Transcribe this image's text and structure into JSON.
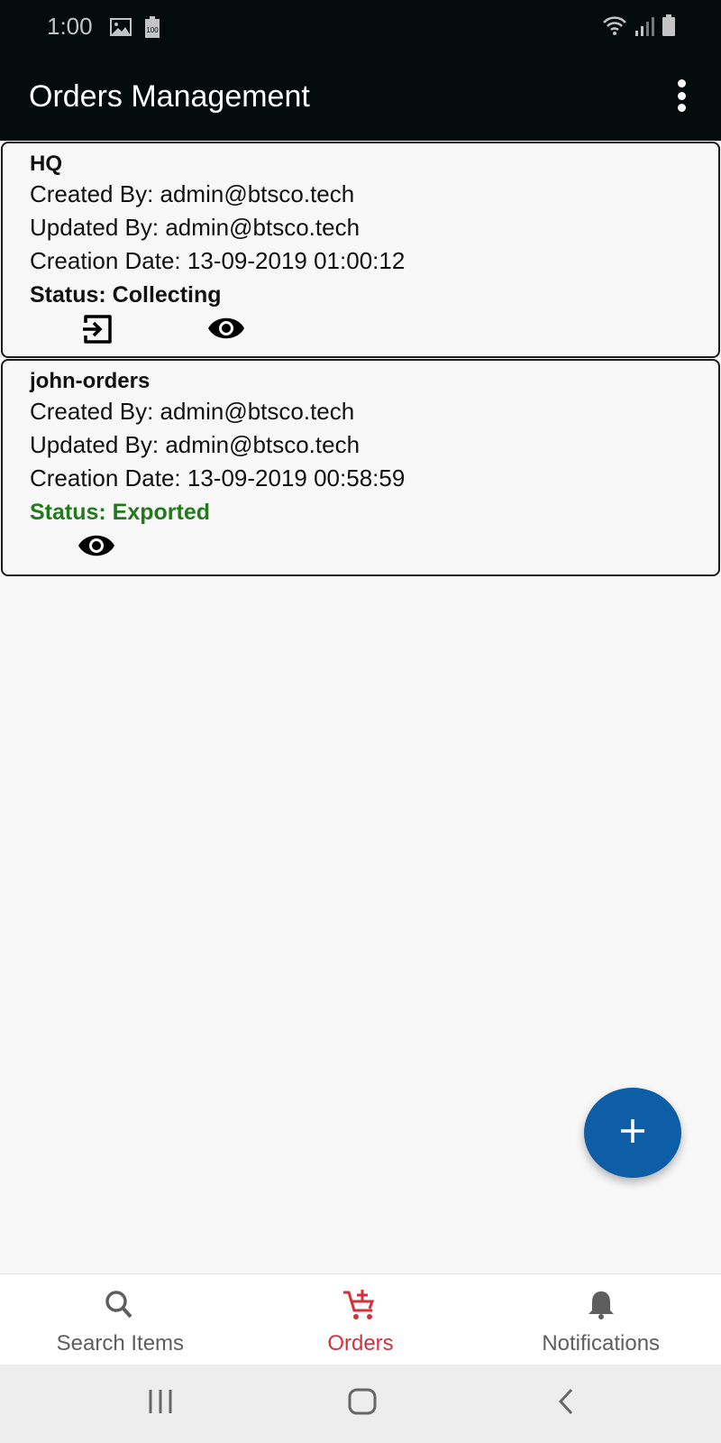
{
  "status_bar": {
    "time": "1:00",
    "left_icons": [
      "image-icon",
      "battery-saver-100-icon"
    ],
    "battery_badge": "100",
    "right_icons": [
      "wifi-icon",
      "signal-icon",
      "battery-icon"
    ]
  },
  "app_bar": {
    "title": "Orders Management",
    "menu_icon": "more-vert-icon"
  },
  "orders": [
    {
      "name": "HQ",
      "created_by": "Created By: admin@btsco.tech",
      "updated_by": "Updated By: admin@btsco.tech",
      "creation_date": "Creation Date: 13-09-2019 01:00:12",
      "status": "Status: Collecting",
      "status_color": "#111111",
      "actions": [
        "export-icon",
        "view-icon"
      ]
    },
    {
      "name": "john-orders",
      "created_by": "Created By: admin@btsco.tech",
      "updated_by": "Updated By: admin@btsco.tech",
      "creation_date": "Creation Date: 13-09-2019 00:58:59",
      "status": "Status: Exported",
      "status_color": "#237a1c",
      "actions": [
        "view-icon"
      ]
    }
  ],
  "fab": {
    "icon": "plus-icon",
    "color": "#0d5ea7"
  },
  "bottom_nav": {
    "active_color": "#d3323d",
    "items": [
      {
        "label": "Search Items",
        "icon": "search-icon",
        "active": false
      },
      {
        "label": "Orders",
        "icon": "cart-add-icon",
        "active": true
      },
      {
        "label": "Notifications",
        "icon": "bell-icon",
        "active": false
      }
    ]
  },
  "system_nav": [
    "recent-apps-icon",
    "home-icon",
    "back-icon"
  ]
}
